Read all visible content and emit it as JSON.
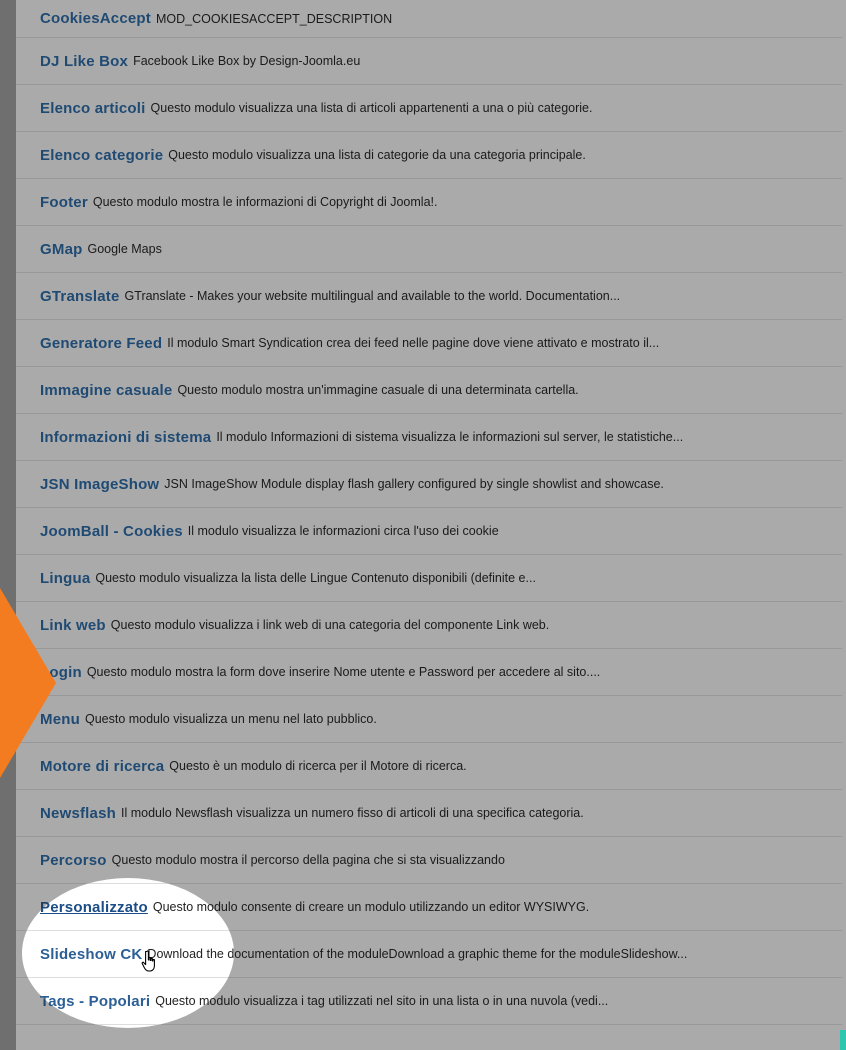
{
  "modules": [
    {
      "title": "CookiesAccept",
      "desc": "MOD_COOKIESACCEPT_DESCRIPTION"
    },
    {
      "title": "DJ Like Box",
      "desc": "Facebook Like Box by Design-Joomla.eu"
    },
    {
      "title": "Elenco articoli",
      "desc": "Questo modulo visualizza una lista di articoli appartenenti a una o più categorie."
    },
    {
      "title": "Elenco categorie",
      "desc": "Questo modulo visualizza una lista di categorie da una categoria principale."
    },
    {
      "title": "Footer",
      "desc": "Questo modulo mostra le informazioni di Copyright di Joomla!."
    },
    {
      "title": "GMap",
      "desc": "Google Maps"
    },
    {
      "title": "GTranslate",
      "desc": "GTranslate - Makes your website multilingual and available to the world. Documentation..."
    },
    {
      "title": "Generatore Feed",
      "desc": "Il modulo Smart Syndication crea dei feed nelle pagine dove viene attivato e mostrato il..."
    },
    {
      "title": "Immagine casuale",
      "desc": "Questo modulo mostra un'immagine casuale di una determinata cartella."
    },
    {
      "title": "Informazioni di sistema",
      "desc": "Il modulo Informazioni di sistema visualizza le informazioni sul server, le statistiche..."
    },
    {
      "title": "JSN ImageShow",
      "desc": "JSN ImageShow Module display flash gallery configured by single showlist and showcase."
    },
    {
      "title": "JoomBall - Cookies",
      "desc": "Il modulo visualizza le informazioni circa l'uso dei cookie"
    },
    {
      "title": "Lingua",
      "desc": "Questo modulo visualizza la lista delle Lingue Contenuto disponibili (definite e..."
    },
    {
      "title": "Link web",
      "desc": "Questo modulo visualizza i link web di una categoria del componente Link web."
    },
    {
      "title": "Login",
      "desc": "Questo modulo mostra la form dove inserire Nome utente e Password per accedere al sito...."
    },
    {
      "title": "Menu",
      "desc": "Questo modulo visualizza un menu nel lato pubblico."
    },
    {
      "title": "Motore di ricerca",
      "desc": "Questo è un modulo di ricerca per il Motore di ricerca."
    },
    {
      "title": "Newsflash",
      "desc": "Il modulo Newsflash visualizza un numero fisso di articoli di una specifica categoria."
    },
    {
      "title": "Percorso",
      "desc": "Questo modulo mostra il percorso della pagina che si sta visualizzando"
    },
    {
      "title": "Personalizzato",
      "desc": "Questo modulo consente di creare un modulo utilizzando un editor WYSIWYG."
    },
    {
      "title": "Slideshow CK",
      "desc": "Download the documentation of the moduleDownload a graphic theme for the moduleSlideshow..."
    },
    {
      "title": "Tags - Popolari",
      "desc": "Questo modulo visualizza i tag utilizzati nel sito in una lista o in una nuvola (vedi..."
    }
  ],
  "highlighted_module": "Personalizzato",
  "colors": {
    "title_link": "#1f4a73",
    "arrow_orange": "#f47c20",
    "accent_teal": "#2fc6b0"
  },
  "icons": {
    "pointer": "hand-pointer-icon",
    "arrow": "orange-arrow-icon"
  }
}
